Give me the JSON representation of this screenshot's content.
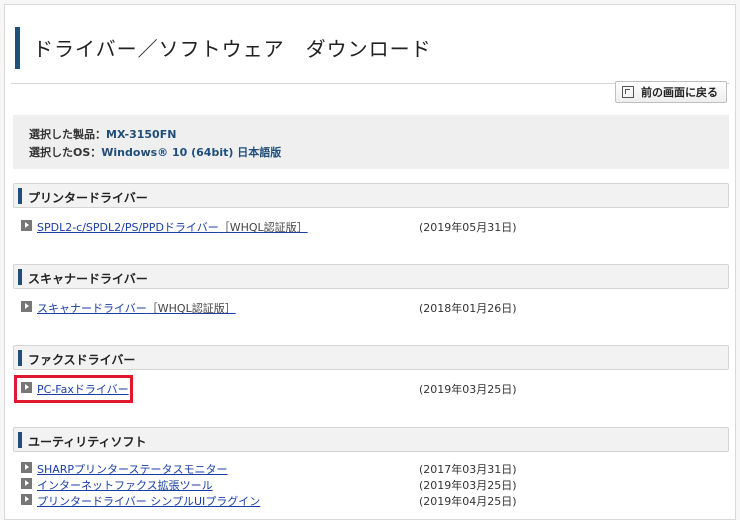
{
  "header": {
    "title": "ドライバー／ソフトウェア　ダウンロード"
  },
  "back_button": {
    "label": "前の画面に戻る",
    "icon": "back-icon"
  },
  "selection": {
    "product_label": "選択した製品：",
    "product_value": "MX-3150FN",
    "os_label": "選択したOS：",
    "os_value": "Windows® 10 (64bit) 日本語版"
  },
  "sections": [
    {
      "title": "プリンタードライバー",
      "items": [
        {
          "link": "SPDL2-c/SPDL2/PS/PPDドライバー",
          "note": "［WHQL認証版］",
          "date": "(2019年05月31日)"
        }
      ]
    },
    {
      "title": "スキャナードライバー",
      "items": [
        {
          "link": "スキャナードライバー",
          "note": "［WHQL認証版］",
          "date": "(2018年01月26日)"
        }
      ]
    },
    {
      "title": "ファクスドライバー",
      "items": [
        {
          "link": "PC-Faxドライバー",
          "note": "",
          "date": "(2019年03月25日)"
        }
      ]
    },
    {
      "title": "ユーティリティソフト",
      "items": [
        {
          "link": "SHARPプリンターステータスモニター",
          "note": "",
          "date": "(2017年03月31日)"
        },
        {
          "link": "インターネットファクス拡張ツール",
          "note": "",
          "date": "(2019年03月25日)"
        },
        {
          "link": "プリンタードライバー シンプルUIプラグイン",
          "note": "",
          "date": "(2019年04月25日)"
        }
      ]
    }
  ],
  "colors": {
    "accent": "#1f4e79",
    "link": "#1a3ea6",
    "highlight": "#e0182d"
  }
}
